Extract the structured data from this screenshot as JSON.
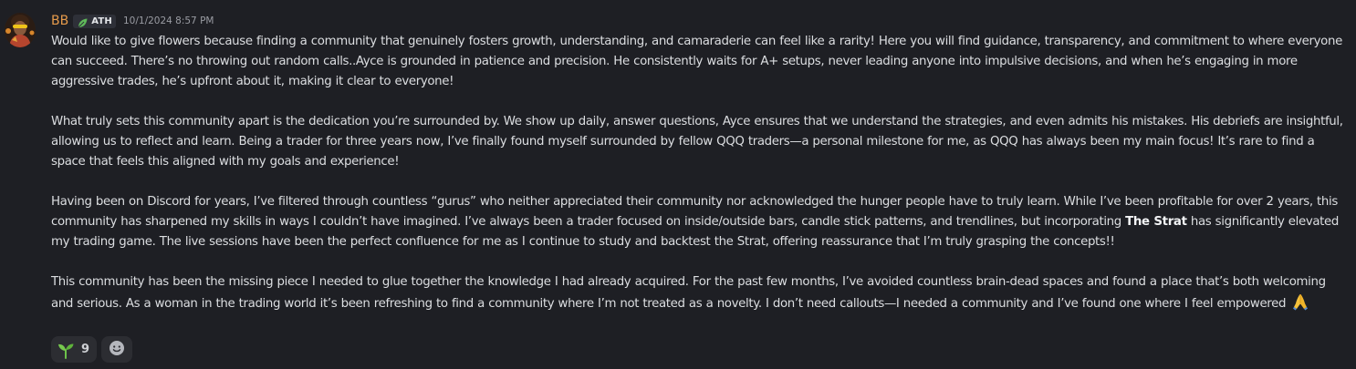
{
  "message": {
    "author": "BB",
    "tag": {
      "label": "ATH",
      "icon": "leaf-icon"
    },
    "timestamp": "10/1/2024 8:57 PM",
    "paragraphs": [
      {
        "text": "Would like to give flowers because finding a community that genuinely fosters growth, understanding, and camaraderie can feel like a rarity! Here you will find guidance, transparency, and commitment to where everyone can succeed. There’s no throwing out random calls..Ayce is grounded in patience and precision. He consistently waits for A+ setups, never leading anyone into impulsive decisions, and when he’s engaging in more aggressive trades, he’s upfront about it, making it clear to everyone!"
      },
      {
        "text": "What truly sets this community apart is the dedication you’re surrounded by. We show up daily, answer questions, Ayce ensures that we understand the strategies, and even admits his mistakes. His debriefs are insightful, allowing us to reflect and learn. Being a trader for three years now, I’ve finally found myself surrounded by fellow QQQ traders—a personal milestone for me, as QQQ has always been my main focus! It’s rare to find a space that feels this aligned with my goals and experience!"
      },
      {
        "before": "Having been on Discord for years, I’ve filtered through countless “gurus” who neither appreciated their community nor acknowledged the hunger people have to truly learn. While I’ve been profitable for over 2 years, this community has sharpened my skills in ways I couldn’t have imagined. I’ve always been a trader focused on inside/outside bars, candle stick patterns, and trendlines, but incorporating ",
        "bold": "The Strat",
        "after": " has significantly elevated my trading game. The live sessions have been the perfect confluence for me as I continue to study and backtest the Strat, offering reassurance that I’m truly grasping the concepts!!"
      },
      {
        "text": "This community has been the missing piece I needed to glue together the knowledge I had already acquired. For the past few months, I’ve avoided countless brain-dead spaces and found a place that’s both welcoming and serious. As a woman in the trading world it’s been refreshing to find a community where I’m not treated as a novelty. I don’t need callouts—I needed a community and I’ve found one where I feel empowered",
        "trailing_emoji": "folded-hands-emoji"
      }
    ],
    "reactions": [
      {
        "emoji": "seedling-emoji",
        "count": "9"
      }
    ],
    "add_reaction_icon": "add-reaction-icon"
  },
  "colors": {
    "background": "#1e1f24",
    "username": "#e59a4b",
    "text": "#dcdee1",
    "timestamp": "#9a9ca3",
    "reaction_bg": "#2c2d32"
  }
}
